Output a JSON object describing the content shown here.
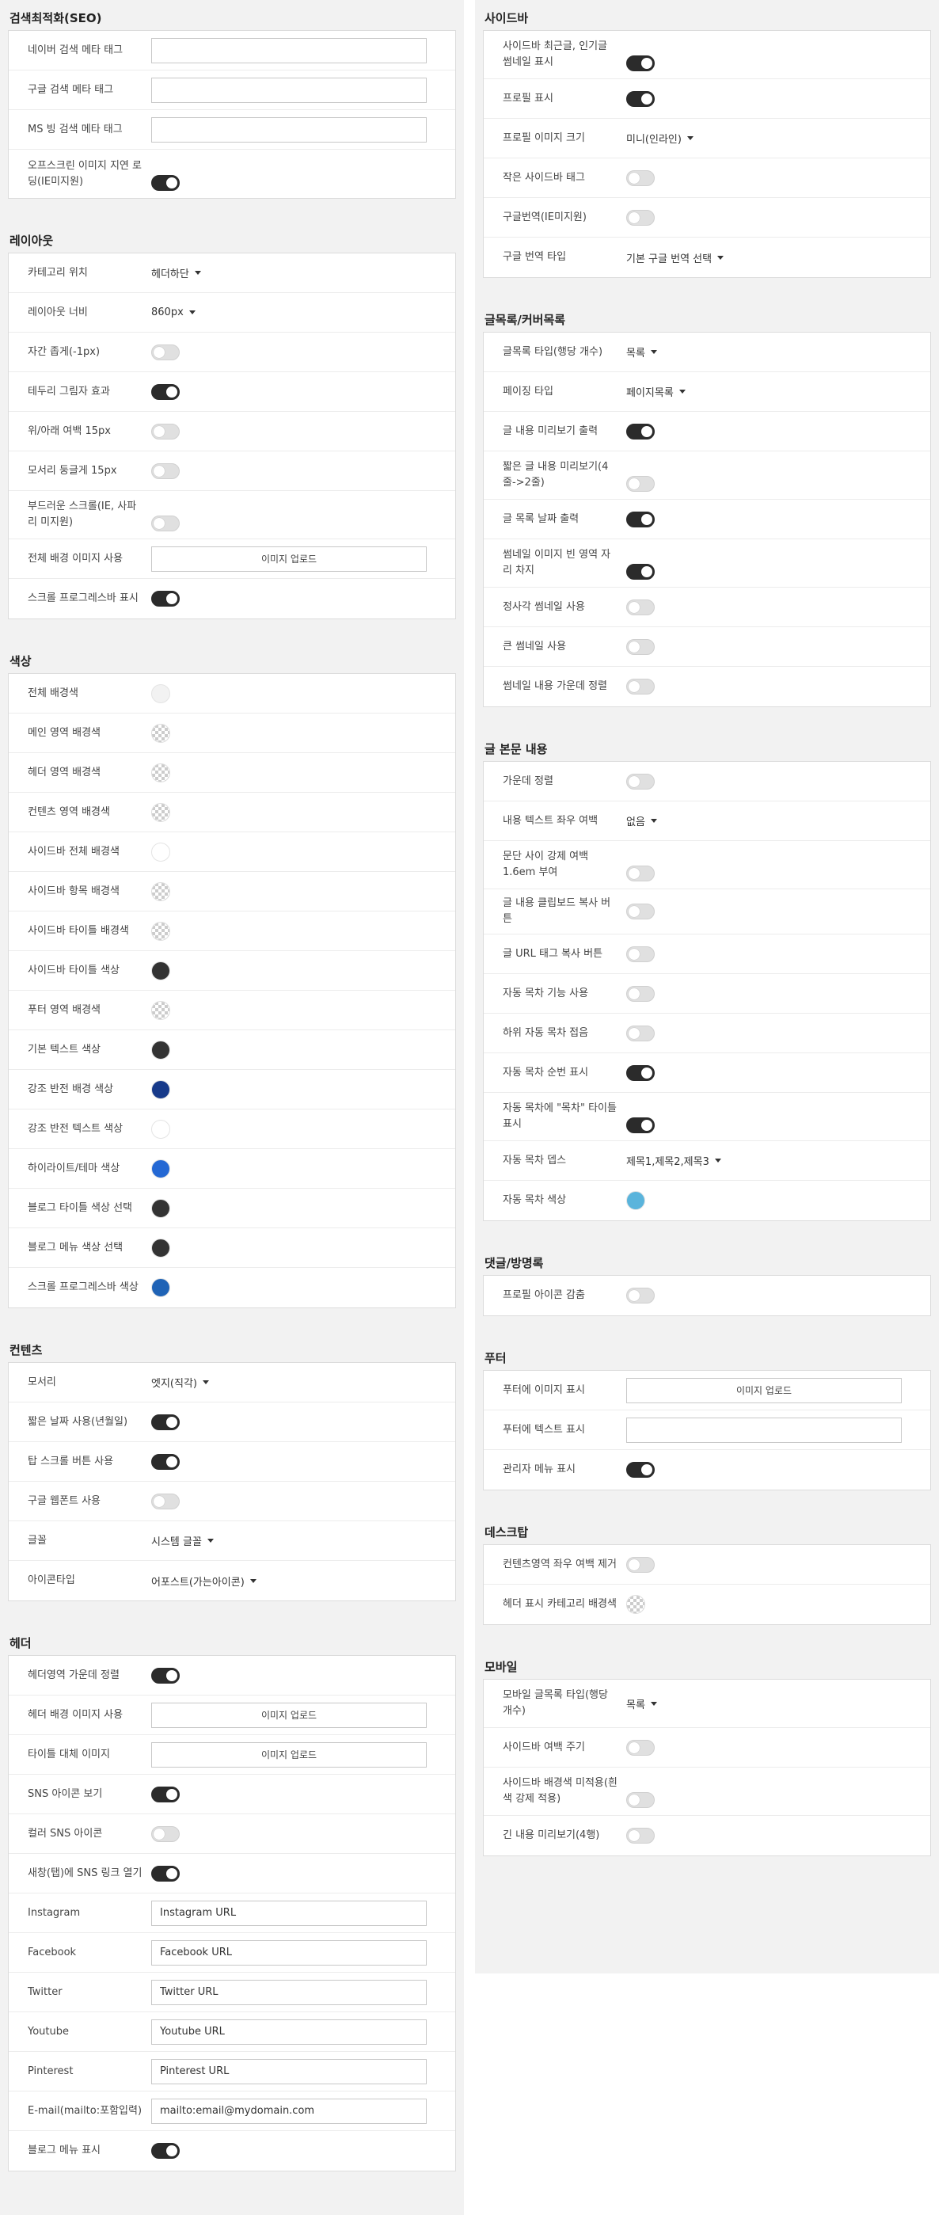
{
  "left": {
    "seo": {
      "title": "검색최적화(SEO)",
      "naver_label": "네이버 검색 메타 태그",
      "google_label": "구글 검색 메타 태그",
      "ms_label": "MS 빙 검색 메타 태그",
      "offscreen_label": "오프스크린 이미지 지연 로딩(IE미지원)",
      "offscreen_on": true
    },
    "layout": {
      "title": "레이아웃",
      "category_pos_label": "카테고리 위치",
      "category_pos_value": "헤더하단",
      "width_label": "레이아웃 너비",
      "width_value": "860px",
      "letter_label": "자간 좁게(-1px)",
      "shadow_label": "테두리 그림자 효과",
      "margin_label": "위/아래 여백 15px",
      "radius_label": "모서리 둥글게 15px",
      "smooth_label": "부드러운 스크롤(IE, 사파리 미지원)",
      "bgimg_label": "전체 배경 이미지 사용",
      "upload_label": "이미지 업로드",
      "progress_label": "스크롤 프로그레스바 표시"
    },
    "colors": {
      "title": "색상",
      "items": [
        {
          "label": "전체 배경색",
          "color": "#f2f2f2",
          "transparent": false
        },
        {
          "label": "메인 영역 배경색",
          "color": "",
          "transparent": true
        },
        {
          "label": "헤더 영역 배경색",
          "color": "",
          "transparent": true
        },
        {
          "label": "컨텐츠 영역 배경색",
          "color": "",
          "transparent": true
        },
        {
          "label": "사이드바 전체 배경색",
          "color": "#ffffff",
          "transparent": false
        },
        {
          "label": "사이드바 항목 배경색",
          "color": "",
          "transparent": true
        },
        {
          "label": "사이드바 타이틀 배경색",
          "color": "",
          "transparent": true
        },
        {
          "label": "사이드바 타이틀 색상",
          "color": "#333333",
          "transparent": false
        },
        {
          "label": "푸터 영역 배경색",
          "color": "",
          "transparent": true
        },
        {
          "label": "기본 텍스트 색상",
          "color": "#333333",
          "transparent": false
        },
        {
          "label": "강조 반전 배경 색상",
          "color": "#173a8a",
          "transparent": false
        },
        {
          "label": "강조 반전 텍스트 색상",
          "color": "#ffffff",
          "transparent": false
        },
        {
          "label": "하이라이트/테마 색상",
          "color": "#2468d4",
          "transparent": false
        },
        {
          "label": "블로그 타이틀 색상 선택",
          "color": "#333333",
          "transparent": false
        },
        {
          "label": "블로그 메뉴 색상 선택",
          "color": "#333333",
          "transparent": false
        },
        {
          "label": "스크롤 프로그레스바 색상",
          "color": "#1f63b6",
          "transparent": false
        }
      ]
    },
    "contents": {
      "title": "컨텐츠",
      "corner_label": "모서리",
      "corner_value": "엣지(직각)",
      "shortdate_label": "짧은 날짜 사용(년월일)",
      "topscroll_label": "탑 스크롤 버튼 사용",
      "webfont_label": "구글 웹폰트 사용",
      "font_label": "글꼴",
      "font_value": "시스템 글꼴",
      "icon_label": "아이콘타입",
      "icon_value": "어포스트(가는아이콘)"
    },
    "header": {
      "title": "헤더",
      "center_label": "헤더영역 가운데 정렬",
      "bgimg_label": "헤더 배경 이미지 사용",
      "titleimg_label": "타이틀 대체 이미지",
      "upload_label": "이미지 업로드",
      "sns_label": "SNS 아이콘 보기",
      "color_sns_label": "컬러 SNS 아이콘",
      "newtab_label": "새창(탭)에 SNS 링크 열기",
      "instagram_label": "Instagram",
      "instagram_value": "Instagram URL",
      "facebook_label": "Facebook",
      "facebook_value": "Facebook URL",
      "twitter_label": "Twitter",
      "twitter_value": "Twitter URL",
      "youtube_label": "Youtube",
      "youtube_value": "Youtube URL",
      "pinterest_label": "Pinterest",
      "pinterest_value": "Pinterest URL",
      "email_label": "E-mail(mailto:포함입력)",
      "email_value": "mailto:email@mydomain.com",
      "blogmenu_label": "블로그 메뉴 표시"
    }
  },
  "right": {
    "sidebar": {
      "title": "사이드바",
      "recent_label": "사이드바 최근글, 인기글 썸네일 표시",
      "profile_label": "프로필 표시",
      "profile_size_label": "프로필 이미지 크기",
      "profile_size_value": "미니(인라인)",
      "small_tag_label": "작은 사이드바 태그",
      "translate_label": "구글번역(IE미지원)",
      "translate_type_label": "구글 번역 타입",
      "translate_type_value": "기본 구글 번역 선택"
    },
    "list": {
      "title": "글목록/커버목록",
      "type_label": "글목록 타입(행당 개수)",
      "type_value": "목록",
      "paging_label": "페이징 타입",
      "paging_value": "페이지목록",
      "preview_label": "글 내용 미리보기 출력",
      "short_preview_label": "짧은 글 내용 미리보기(4줄->2줄)",
      "date_label": "글 목록 날짜 출력",
      "thumb_space_label": "썸네일 이미지 빈 영역 자리 차지",
      "square_thumb_label": "정사각 썸네일 사용",
      "big_thumb_label": "큰 썸네일 사용",
      "thumb_center_label": "썸네일 내용 가운데 정렬"
    },
    "body": {
      "title": "글 본문 내용",
      "center_label": "가운데 정렬",
      "side_margin_label": "내용 텍스트 좌우 여백",
      "side_margin_value": "없음",
      "para_label": "문단 사이 강제 여백 1.6em 부여",
      "clipboard_label": "글 내용 클립보드 복사 버튼",
      "urltag_label": "글 URL 태그 복사 버튼",
      "toc_label": "자동 목차 기능 사용",
      "subtoc_label": "하위 자동 목차 접음",
      "tocnum_label": "자동 목차 순번 표시",
      "toctitle_label": "자동 목차에 \"목차\" 타이틀 표시",
      "tocdepth_label": "자동 목차 뎁스",
      "tocdepth_value": "제목1,제목2,제목3",
      "toccolor_label": "자동 목차 색상",
      "toccolor": "#5ab4dc"
    },
    "comments": {
      "title": "댓글/방명록",
      "hide_profile_label": "프로필 아이콘 감춤"
    },
    "footer": {
      "title": "푸터",
      "img_label": "푸터에 이미지 표시",
      "upload_label": "이미지 업로드",
      "text_label": "푸터에 텍스트 표시",
      "admin_label": "관리자 메뉴 표시"
    },
    "desktop": {
      "title": "데스크탑",
      "nomargin_label": "컨텐츠영역 좌우 여백 제거",
      "catbg_label": "헤더 표시 카테고리 배경색"
    },
    "mobile": {
      "title": "모바일",
      "list_label": "모바일 글목록 타입(행당 개수)",
      "list_value": "목록",
      "sidebar_margin_label": "사이드바 여백 주기",
      "sidebar_bg_label": "사이드바 배경색 미적용(흰색 강제 적용)",
      "long_preview_label": "긴 내용 미리보기(4행)"
    }
  }
}
